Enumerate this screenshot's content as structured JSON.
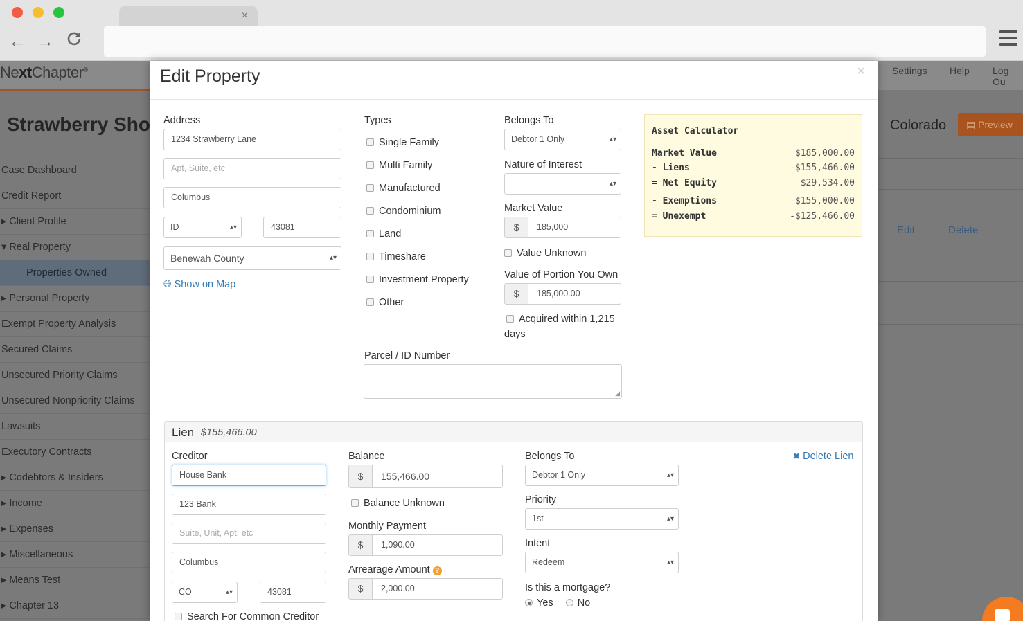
{
  "browser": {
    "tab_close": "×",
    "back": "←",
    "forward": "→",
    "reload": "C"
  },
  "app": {
    "logo_a": "Ne",
    "logo_b": "xt",
    "logo_c": "Chapter",
    "logo_mark": "®",
    "nav": [
      "Settings",
      "Help",
      "Log Ou"
    ],
    "case_title": "Strawberry Shor",
    "state": "Colorado",
    "preview_label": "Preview",
    "edit_link": "Edit",
    "delete_link": "Delete",
    "sidebar": [
      {
        "label": "Case Dashboard",
        "arrow": ""
      },
      {
        "label": "Credit Report",
        "arrow": ""
      },
      {
        "label": "Client Profile",
        "arrow": "▸ "
      },
      {
        "label": "Real Property",
        "arrow": "▾ "
      },
      {
        "label": "Properties Owned",
        "arrow": ""
      },
      {
        "label": "Personal Property",
        "arrow": "▸ "
      },
      {
        "label": "Exempt Property Analysis",
        "arrow": ""
      },
      {
        "label": "Secured Claims",
        "arrow": ""
      },
      {
        "label": "Unsecured Priority Claims",
        "arrow": ""
      },
      {
        "label": "Unsecured Nonpriority Claims",
        "arrow": ""
      },
      {
        "label": "Lawsuits",
        "arrow": ""
      },
      {
        "label": "Executory Contracts",
        "arrow": ""
      },
      {
        "label": "Codebtors & Insiders",
        "arrow": "▸ "
      },
      {
        "label": "Income",
        "arrow": "▸ "
      },
      {
        "label": "Expenses",
        "arrow": "▸ "
      },
      {
        "label": "Miscellaneous",
        "arrow": "▸ "
      },
      {
        "label": "Means Test",
        "arrow": "▸ "
      },
      {
        "label": "Chapter 13",
        "arrow": "▸ "
      }
    ]
  },
  "modal": {
    "title": "Edit Property",
    "close": "×",
    "address": {
      "label": "Address",
      "street": "1234 Strawberry Lane",
      "apt_placeholder": "Apt, Suite, etc",
      "city": "Columbus",
      "state": "ID",
      "zip": "43081",
      "county": "Benewah County",
      "map_link": "Show on Map"
    },
    "types": {
      "label": "Types",
      "options": [
        "Single Family",
        "Multi Family",
        "Manufactured",
        "Condominium",
        "Land",
        "Timeshare",
        "Investment Property",
        "Other"
      ]
    },
    "belongs_to": {
      "label": "Belongs To",
      "value": "Debtor 1 Only"
    },
    "nature_of_interest": {
      "label": "Nature of Interest",
      "value": ""
    },
    "market_value": {
      "label": "Market Value",
      "currency": "$",
      "value": "185,000"
    },
    "value_unknown": "Value Unknown",
    "portion_value": {
      "label": "Value of Portion You Own",
      "currency": "$",
      "value": "185,000.00"
    },
    "acquired_line1": "Acquired within 1,215",
    "acquired_line2": "days",
    "parcel": {
      "label": "Parcel / ID Number",
      "value": ""
    },
    "calculator": {
      "title": "Asset Calculator",
      "rows": [
        {
          "k": "Market Value",
          "v": "$185,000.00"
        },
        {
          "k": "- Liens",
          "v": "-$155,466.00"
        },
        {
          "k": "= Net Equity",
          "v": "$29,534.00"
        },
        {
          "k": "- Exemptions",
          "v": "-$155,000.00"
        },
        {
          "k": "= Unexempt",
          "v": "-$125,466.00"
        }
      ]
    },
    "lien": {
      "title": "Lien",
      "amount": "$155,466.00",
      "creditor": {
        "label": "Creditor",
        "name": "House Bank",
        "street": "123 Bank",
        "suite_placeholder": "Suite, Unit, Apt, etc",
        "city": "Columbus",
        "state": "CO",
        "zip": "43081",
        "search_common": "Search For Common Creditor"
      },
      "balance": {
        "label": "Balance",
        "currency": "$",
        "value": "155,466.00"
      },
      "balance_unknown": "Balance Unknown",
      "monthly_payment": {
        "label": "Monthly Payment",
        "currency": "$",
        "value": "1,090.00"
      },
      "arrearage": {
        "label": "Arrearage Amount",
        "currency": "$",
        "value": "2,000.00",
        "help": "?"
      },
      "belongs_to": {
        "label": "Belongs To",
        "value": "Debtor 1 Only"
      },
      "priority": {
        "label": "Priority",
        "value": "1st"
      },
      "intent": {
        "label": "Intent",
        "value": "Redeem"
      },
      "mortgage": {
        "label": "Is this a mortgage?",
        "yes": "Yes",
        "no": "No"
      },
      "delete_label": "Delete Lien",
      "delete_mark": "✖"
    }
  },
  "colors": {
    "accent": "#337ab7",
    "brand_orange": "#f47b20",
    "calc_bg": "#fefbe0"
  }
}
